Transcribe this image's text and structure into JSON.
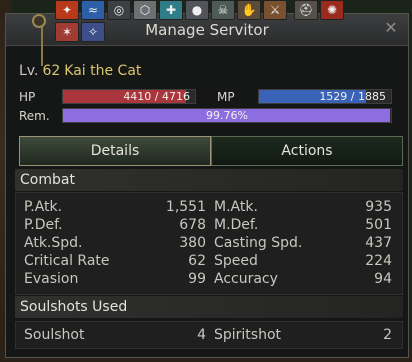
{
  "window": {
    "title": "Manage Servitor",
    "close_glyph": "✕"
  },
  "buffs": [
    {
      "icon": "flame-icon",
      "color": "#b8391c",
      "glyph": "✦"
    },
    {
      "icon": "wave-icon",
      "color": "#2d5fa8",
      "glyph": "≈"
    },
    {
      "icon": "circle-icon",
      "color": "#3d3f42",
      "glyph": "◎"
    },
    {
      "icon": "shield-icon",
      "color": "#6d6f72",
      "glyph": "⬡"
    },
    {
      "icon": "cross-icon",
      "color": "#2f7d86",
      "glyph": "✚"
    },
    {
      "icon": "orb-icon",
      "color": "#52545a",
      "glyph": "●"
    },
    {
      "icon": "skull-icon",
      "color": "#4d5a55",
      "glyph": "☠"
    },
    {
      "icon": "hand-icon",
      "color": "#5c4a3a",
      "glyph": "✋"
    },
    {
      "icon": "sword-icon",
      "color": "#7a5130",
      "glyph": "⚔"
    },
    {
      "icon": "spark-icon",
      "color": "#a03c34",
      "glyph": "✶"
    },
    {
      "icon": "star-icon",
      "color": "#3c4f8a",
      "glyph": "✧"
    },
    {
      "icon": "helmet-icon",
      "color": "#55504a",
      "glyph": "⛑"
    },
    {
      "icon": "burst-icon",
      "color": "#9b2a1e",
      "glyph": "✺"
    }
  ],
  "servitor": {
    "level_label": "Lv.",
    "level": "62",
    "name": "Kai the Cat"
  },
  "bars": {
    "hp": {
      "label": "HP",
      "text": "4410 / 4716",
      "fraction": 0.935,
      "color": "#a8363c"
    },
    "mp": {
      "label": "MP",
      "text": "1529 / 1885",
      "fraction": 0.811,
      "color": "#3a63b8"
    },
    "rem": {
      "label": "Rem.",
      "text": "99.76%",
      "fraction": 0.9976,
      "color": "#8d6ee0"
    }
  },
  "tabs": [
    {
      "label": "Details",
      "active": true
    },
    {
      "label": "Actions",
      "active": false
    }
  ],
  "combat": {
    "header": "Combat",
    "left": [
      {
        "label": "P.Atk.",
        "value": "1,551"
      },
      {
        "label": "P.Def.",
        "value": "678"
      },
      {
        "label": "Atk.Spd.",
        "value": "380"
      },
      {
        "label": "Critical Rate",
        "value": "62"
      },
      {
        "label": "Evasion",
        "value": "99"
      }
    ],
    "right": [
      {
        "label": "M.Atk.",
        "value": "935"
      },
      {
        "label": "M.Def.",
        "value": "501"
      },
      {
        "label": "Casting Spd.",
        "value": "437"
      },
      {
        "label": "Speed",
        "value": "224"
      },
      {
        "label": "Accuracy",
        "value": "94"
      }
    ]
  },
  "soulshots": {
    "header": "Soulshots Used",
    "soulshot_label": "Soulshot",
    "soulshot_value": "4",
    "spiritshot_label": "Spiritshot",
    "spiritshot_value": "2"
  }
}
